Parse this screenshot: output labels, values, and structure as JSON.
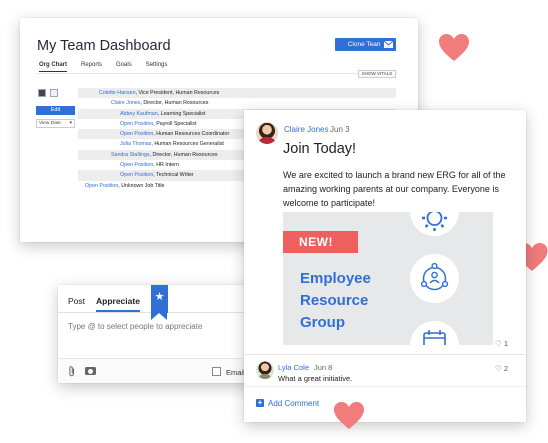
{
  "dashboard": {
    "title": "My Team Dashboard",
    "clone_button": "Clone Team",
    "tabs": [
      "Org Chart",
      "Reports",
      "Goals",
      "Settings"
    ],
    "show_vitals": "SHOW VITALS",
    "edit_button": "Edit",
    "view_date": "View Date",
    "org": [
      {
        "name": "Colette Hansen",
        "role": ", Vice President, Human Resources"
      },
      {
        "name": "Claire Jones",
        "role": ", Director, Human Resources"
      },
      {
        "name": "Abbey Kaufman",
        "role": ", Learning Specialist"
      },
      {
        "name": "Open Position",
        "role": ", Payroll Specialist"
      },
      {
        "name": "Open Position",
        "role": ", Human Resources Coordinator"
      },
      {
        "name": "Julia Thomas",
        "role": ", Human Resources Generalist"
      },
      {
        "name": "Sandra Stallings",
        "role": ", Director, Human Resources"
      },
      {
        "name": "Open Position",
        "role": ", HR Intern"
      },
      {
        "name": "Open Position",
        "role": ", Technical Writer"
      },
      {
        "name": "Open Position",
        "role": ", Unknown Job Title"
      }
    ]
  },
  "appreciate": {
    "tab_post": "Post",
    "tab_appreciate": "Appreciate",
    "placeholder": "Type @ to select people to appreciate",
    "email_label": "Email"
  },
  "post": {
    "author": "Claire Jones",
    "date": "Jun 3",
    "headline": "Join Today!",
    "body": "We are excited to launch a brand new ERG for all of the amazing working parents at our company. Everyone is welcome to participate!",
    "badge": "NEW!",
    "erg_lines": [
      "Employee",
      "Resource",
      "Group"
    ],
    "likes": "1",
    "comment": {
      "author": "Lyla Cole",
      "date": "Jun 8",
      "text": "What a great initiative.",
      "likes": "2"
    },
    "add_comment": "Add Comment"
  },
  "colors": {
    "accent": "#2f6fd6",
    "badge": "#ee5f5f",
    "heart": "#f07c7c"
  }
}
